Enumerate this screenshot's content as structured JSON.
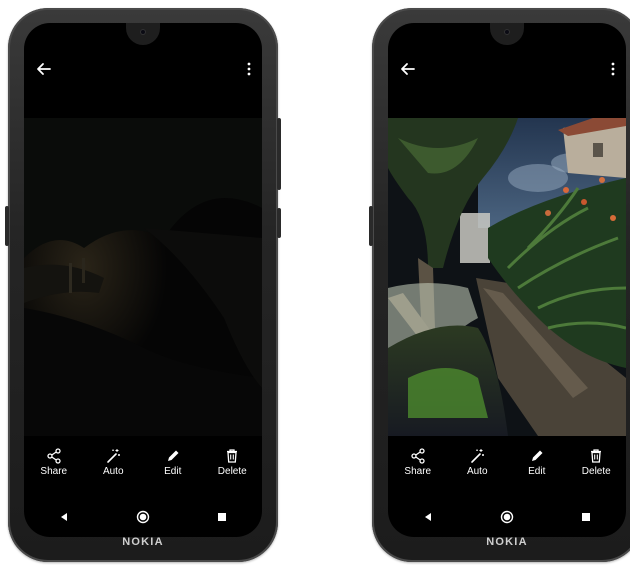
{
  "phones": [
    {
      "id": "left",
      "actions": [
        "Share",
        "Auto",
        "Edit",
        "Delete"
      ],
      "brand": "NOKIA"
    },
    {
      "id": "right",
      "actions": [
        "Share",
        "Auto",
        "Edit",
        "Delete"
      ],
      "brand": "NOKIA"
    }
  ],
  "icons": {
    "back": "arrow-left-icon",
    "more": "more-vertical-icon",
    "share": "share-icon",
    "auto": "magic-wand-icon",
    "edit": "pencil-icon",
    "delete": "trash-icon",
    "nav_back": "triangle-back-icon",
    "nav_home": "circle-home-icon",
    "nav_recents": "square-recents-icon"
  },
  "colors": {
    "phone_body": "#252525",
    "screen_bg": "#000000",
    "text": "#ffffff",
    "brand_text": "#cfcfcf"
  }
}
